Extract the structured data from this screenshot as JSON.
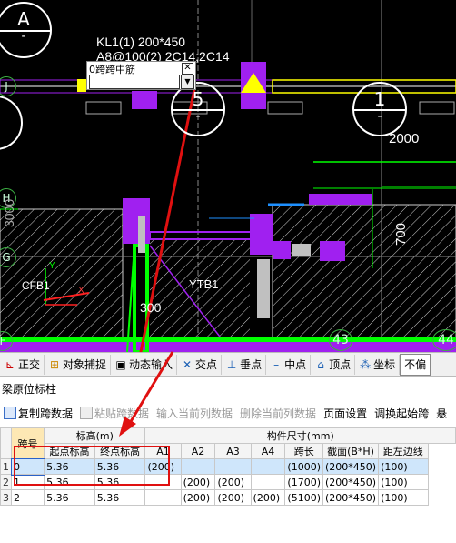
{
  "cad": {
    "axis_bubbles": [
      {
        "letter": "A",
        "sub": "-"
      },
      {
        "letter": "5",
        "sub": "-"
      },
      {
        "letter": "1",
        "sub": "-"
      }
    ],
    "left_axes": [
      "J",
      "H",
      "G",
      "F"
    ],
    "bottom_axes": [
      "43",
      "44"
    ],
    "beam_label_line1": "KL1(1) 200*450",
    "beam_label_line2": "A8@100(2) 2C14;2C14",
    "dim_2000": "2000",
    "dim_700": "700",
    "label_ytb1": "YTB1",
    "label_cfb1": "CFB1",
    "label_300": "300",
    "label_3000": "3000",
    "ucs_x": "X",
    "ucs_y": "Y"
  },
  "edit_popup": {
    "caption": "0跨跨中筋",
    "value": "",
    "close": "✕",
    "dropdown": "▼"
  },
  "snap_toolbar": {
    "items": [
      {
        "icon": "ortho-icon",
        "label": "正交"
      },
      {
        "icon": "object-snap-icon",
        "label": "对象捕捉"
      },
      {
        "icon": "dynamic-input-icon",
        "label": "动态输入"
      },
      {
        "icon": "intersection-icon",
        "label": "交点"
      },
      {
        "icon": "perpendicular-icon",
        "label": "垂点"
      },
      {
        "icon": "midpoint-icon",
        "label": "中点"
      },
      {
        "icon": "vertex-icon",
        "label": "顶点"
      },
      {
        "icon": "coordinate-icon",
        "label": "坐标"
      },
      {
        "icon": "",
        "label": "不偏"
      }
    ]
  },
  "panel": {
    "title": "梁原位标柱",
    "toolbar": [
      {
        "label": "复制跨数据",
        "enabled": true
      },
      {
        "label": "粘贴跨数据",
        "enabled": false
      },
      {
        "label": "输入当前列数据",
        "enabled": false
      },
      {
        "label": "删除当前列数据",
        "enabled": false
      },
      {
        "label": "页面设置",
        "enabled": true
      },
      {
        "label": "调换起始跨",
        "enabled": true
      },
      {
        "label": "悬",
        "enabled": true
      }
    ]
  },
  "grid": {
    "group_headers": {
      "elevation": "标高(m)",
      "dimensions": "构件尺寸(mm)"
    },
    "columns": [
      "跨号",
      "起点标高",
      "终点标高",
      "A1",
      "A2",
      "A3",
      "A4",
      "跨长",
      "截面(B*H)",
      "距左边线"
    ],
    "rows": [
      {
        "num": "1",
        "cells": [
          "0",
          "5.36",
          "5.36",
          "(200)",
          "",
          "",
          "",
          "(1000)",
          "(200*450)",
          "(100)"
        ]
      },
      {
        "num": "2",
        "cells": [
          "1",
          "5.36",
          "5.36",
          "",
          "(200)",
          "(200)",
          "",
          "(1700)",
          "(200*450)",
          "(100)"
        ]
      },
      {
        "num": "3",
        "cells": [
          "2",
          "5.36",
          "5.36",
          "",
          "(200)",
          "(200)",
          "(200)",
          "(5100)",
          "(200*450)",
          "(100)"
        ]
      }
    ]
  },
  "colors": {
    "cad_background": "#000000",
    "magenta_beam": "#a020f0",
    "green_line": "#00ff00",
    "annotation_red": "#e01010",
    "selected_row": "#cfe6fb",
    "highlight_column": "#fde8b4"
  }
}
